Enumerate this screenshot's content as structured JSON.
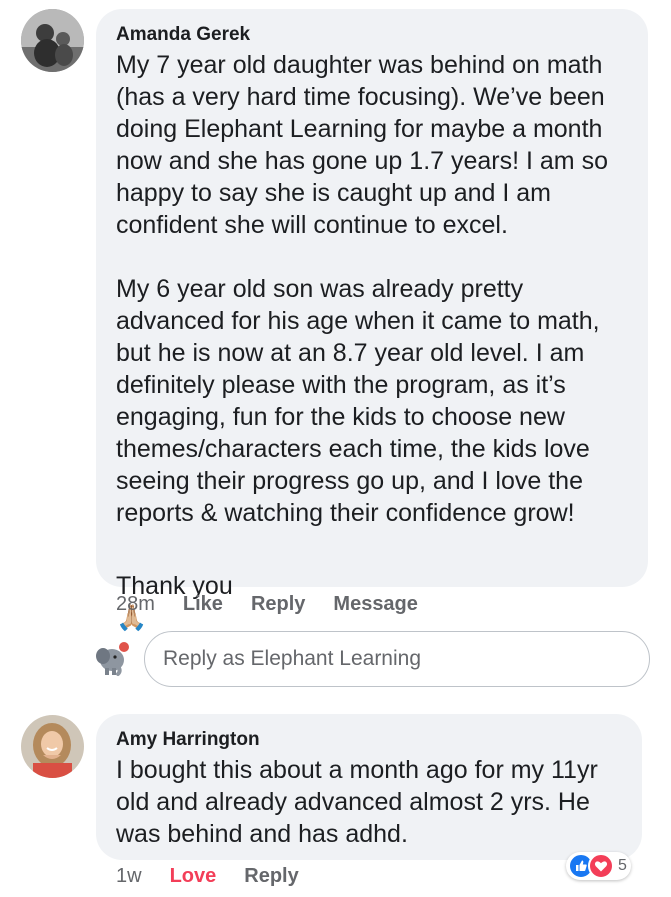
{
  "comments": [
    {
      "author": "Amanda Gerek",
      "text": "My 7 year old daughter was behind on math\n(has a very hard time focusing). We’ve been\ndoing Elephant Learning for maybe a month\nnow and she has gone up 1.7 years! I am so\nhappy to say she is caught up and I am\nconfident she will continue to excel.\n\nMy 6 year old son was already pretty\nadvanced for his age when it came to math,\nbut he is now at an 8.7 year old level. I am\ndefinitely please with the program, as it’s\nengaging, fun for the kids to choose new\nthemes/characters each time, the kids love\nseeing their progress go up, and I love the\nreports & watching their confidence grow!",
      "closing": "Thank you",
      "emoji": "🙏🏼",
      "time": "28m",
      "actions": [
        "Like",
        "Reply",
        "Message"
      ]
    },
    {
      "author": "Amy Harrington",
      "text": "I bought this about a month ago for my 11yr\nold and already advanced almost 2 yrs. He\nwas behind and has adhd.",
      "time": "1w",
      "actions": [
        "Love",
        "Reply"
      ],
      "reaction_count": "5",
      "reaction_icons": [
        "like-icon",
        "love-icon"
      ]
    }
  ],
  "reply_box": {
    "placeholder": "Reply as Elephant Learning"
  },
  "colors": {
    "bubble": "#f0f2f5",
    "love": "#f33e58",
    "like": "#1877f2",
    "muted": "#65676b"
  }
}
